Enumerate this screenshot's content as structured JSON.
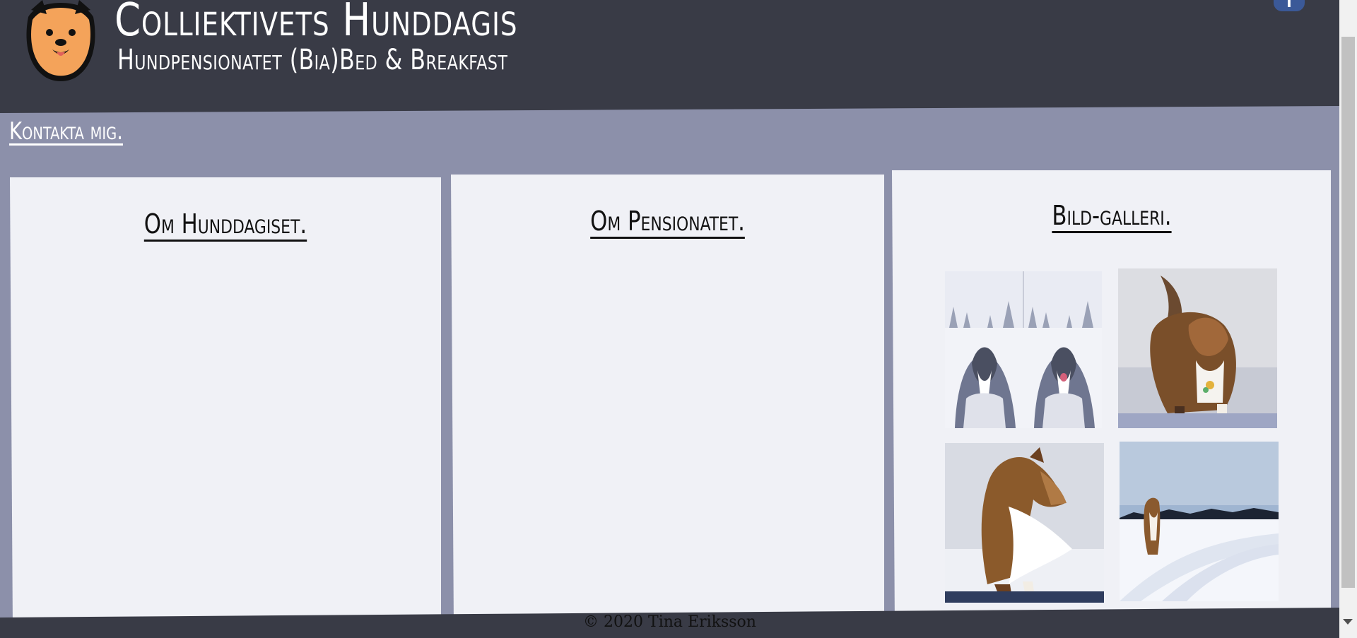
{
  "header": {
    "title": "Colliektivets Hunddagis",
    "subtitle": "Hundpensionatet (Bia)Bed & Breakfast",
    "logo_icon": "dog-face-logo",
    "social_icon": "facebook-icon",
    "social_glyph": "f"
  },
  "nav": {
    "contact_label": "Kontakta mig."
  },
  "panels": [
    {
      "title": "Om Hunddagiset."
    },
    {
      "title": "Om Pensionatet."
    },
    {
      "title": "Bild-galleri."
    }
  ],
  "gallery": {
    "images": [
      {
        "name": "collie-snow-diptych"
      },
      {
        "name": "collie-running-snow"
      },
      {
        "name": "collie-windblown-fur"
      },
      {
        "name": "collie-snow-field"
      }
    ]
  },
  "footer": {
    "copyright": "© 2020 Tina Eriksson"
  },
  "colors": {
    "header_bg": "#393b46",
    "page_bg": "#8c90aa",
    "panel_bg": "#f0f1f6",
    "text_light": "#ffffff",
    "text_dark": "#111111"
  }
}
